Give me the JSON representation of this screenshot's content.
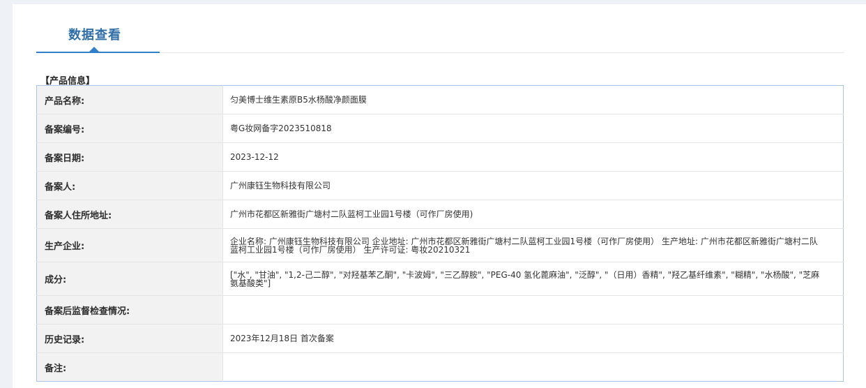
{
  "tab": {
    "title": "数据查看"
  },
  "section": {
    "title": "【产品信息】"
  },
  "rows": [
    {
      "label": "产品名称:",
      "value": "匀美博士维生素原B5水杨酸净颜面膜"
    },
    {
      "label": "备案编号:",
      "value": "粤G妆网备字2023510818"
    },
    {
      "label": "备案日期:",
      "value": "2023-12-12"
    },
    {
      "label": "备案人:",
      "value": "广州康钰生物科技有限公司"
    },
    {
      "label": "备案人住所地址:",
      "value": "广州市花都区新雅街广塘村二队蓝柯工业园1号楼（可作厂房使用)"
    },
    {
      "label": "生产企业:",
      "value": "企业名称: 广州康钰生物科技有限公司 企业地址: 广州市花都区新雅街广塘村二队蓝柯工业园1号楼（可作厂房使用） 生产地址: 广州市花都区新雅街广塘村二队蓝柯工业园1号楼（可作厂房使用） 生产许可证: 粤妆20210321"
    },
    {
      "label": "成分:",
      "value": "[\"水\", \"甘油\", \"1,2-己二醇\", \"对羟基苯乙酮\", \"卡波姆\", \"三乙醇胺\", \"PEG-40 氢化蓖麻油\", \"泛醇\", \"（日用）香精\", \"羟乙基纤维素\", \"糊精\", \"水杨酸\", \"芝麻氨基酸类\"]"
    },
    {
      "label": "备案后监督检查情况:",
      "value": ""
    },
    {
      "label": "历史记录:",
      "value": "2023年12月18日 首次备案"
    },
    {
      "label": "备注:",
      "value": ""
    }
  ],
  "colors": {
    "accent": "#2f80c8",
    "title": "#2f6ea6",
    "table_border": "#a9c4e4",
    "label_bg": "#f2f2f2"
  }
}
